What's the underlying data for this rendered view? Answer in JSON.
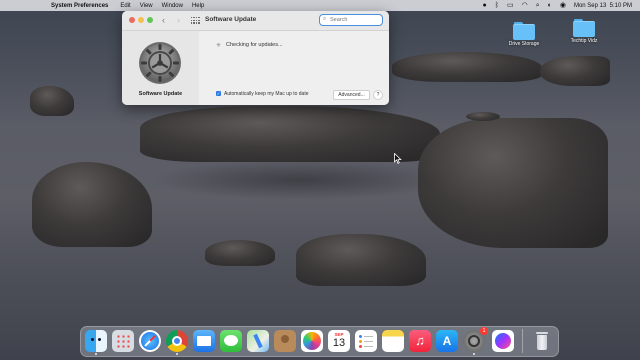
{
  "menubar": {
    "apple": "",
    "app_name": "System Preferences",
    "items": [
      "Edit",
      "View",
      "Window",
      "Help"
    ],
    "datetime": "Mon Sep 13  5:10 PM"
  },
  "desktop": {
    "icons": [
      {
        "label": "Drive Storage"
      },
      {
        "label": "Techtip Vidz"
      }
    ]
  },
  "window": {
    "title": "Software Update",
    "search_placeholder": "Search",
    "pane_label": "Software Update",
    "status": "Checking for updates...",
    "auto_update_label": "Automatically keep my Mac up to date",
    "auto_update_checked": true,
    "advanced_label": "Advanced...",
    "help_label": "?"
  },
  "dock": {
    "apps": [
      "Finder",
      "Launchpad",
      "Safari",
      "Chrome",
      "Mail",
      "Messages",
      "Maps",
      "Contacts",
      "Photos",
      "Calendar",
      "Reminders",
      "Notes",
      "Music",
      "App Store",
      "System Preferences",
      "Messenger",
      "Trash"
    ],
    "calendar_month": "SEP",
    "calendar_day": "13",
    "sysprefs_badge": "1"
  },
  "colors": {
    "accent": "#2f7be6",
    "close": "#ed6a5e",
    "minimize": "#f5bf4f",
    "zoom": "#61c554"
  }
}
